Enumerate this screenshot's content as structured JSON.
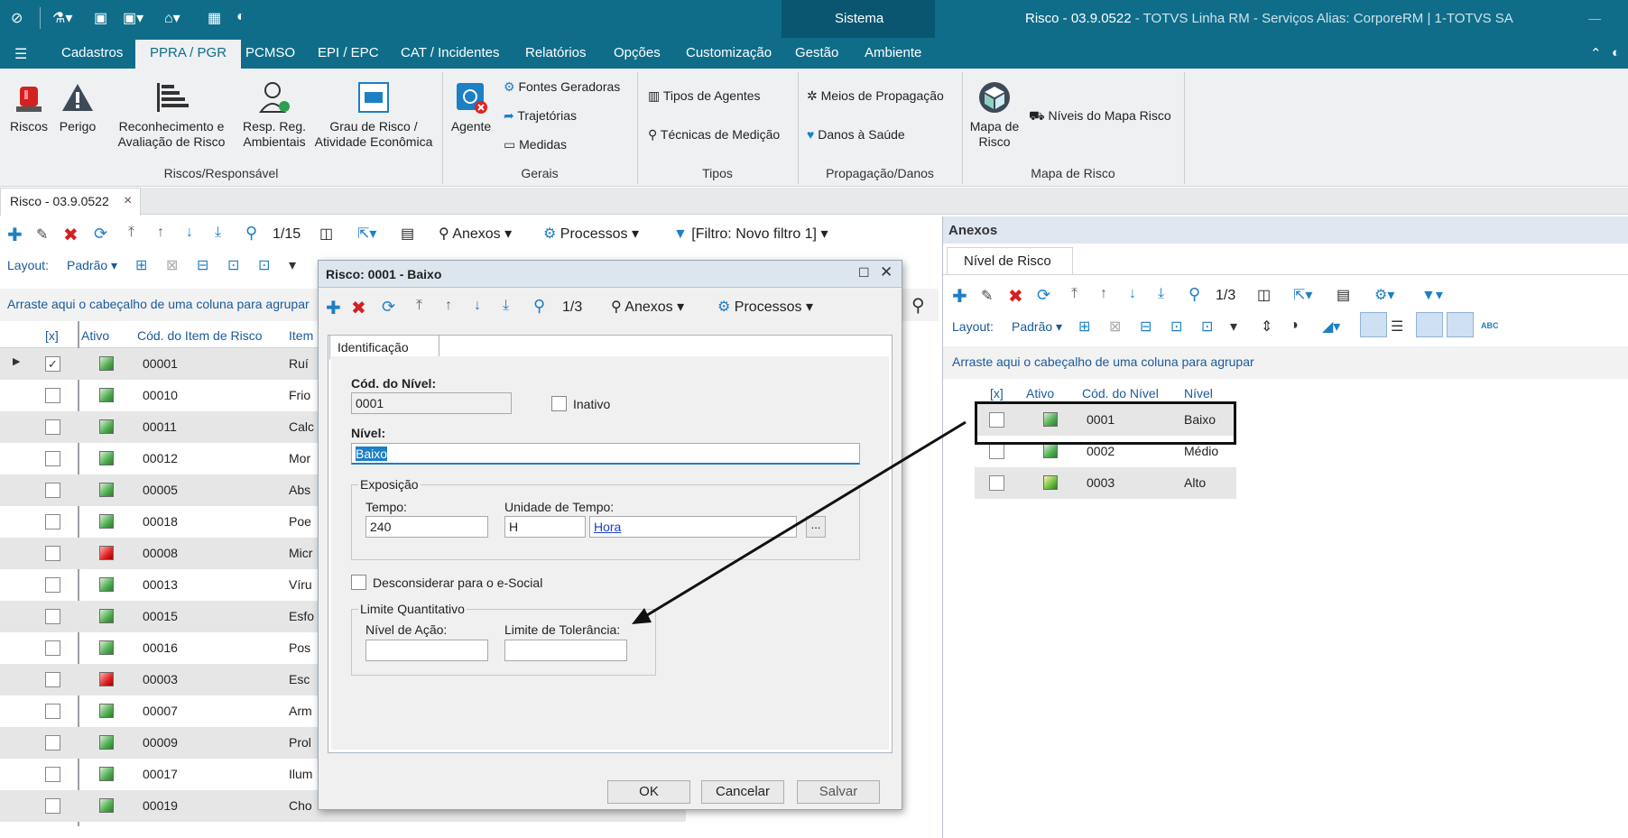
{
  "window": {
    "menu_section": "Sistema",
    "title": "Risco - 03.9.0522",
    "title_suffix": " - TOTVS Linha RM - Serviços  Alias: CorporeRM | 1-TOTVS SA",
    "minimize": "—"
  },
  "menu": {
    "tabs": [
      "Cadastros",
      "PPRA / PGR",
      "PCMSO",
      "EPI / EPC",
      "CAT / Incidentes",
      "Relatórios",
      "Opções",
      "Customização",
      "Gestão",
      "Ambiente"
    ]
  },
  "ribbon": {
    "riscos": "Riscos",
    "perigo": "Perigo",
    "reconhecimento_1": "Reconhecimento e",
    "reconhecimento_2": "Avaliação de Risco",
    "resp_1": "Resp. Reg.",
    "resp_2": "Ambientais",
    "grau_1": "Grau de Risco /",
    "grau_2": "Atividade Econômica",
    "agente": "Agente",
    "fontes": "Fontes Geradoras",
    "trajetorias": "Trajetórias",
    "medidas": "Medidas",
    "tipos_agentes": "Tipos de Agentes",
    "tecnicas": "Técnicas de Medição",
    "meios": "Meios de Propagação",
    "danos": "Danos à Saúde",
    "mapa_1": "Mapa de",
    "mapa_2": "Risco",
    "niveis": "Níveis do Mapa Risco",
    "groups": {
      "g1": "Riscos/Responsável",
      "g2": "Gerais",
      "g3": "Tipos",
      "g4": "Propagação/Danos",
      "g5": "Mapa de Risco"
    }
  },
  "doc_tab": {
    "label": "Risco - 03.9.0522",
    "close": "×"
  },
  "main_grid": {
    "counter": "1/15",
    "anexos": "Anexos",
    "processos": "Processos",
    "filtro": "[Filtro: Novo filtro 1]",
    "layout_label": "Layout:",
    "layout_value": "Padrão",
    "group_hint": "Arraste aqui o cabeçalho de uma coluna para agrupar",
    "headers": [
      "[x]",
      "Ativo",
      "Cód. do Item de Risco",
      "Item"
    ],
    "rows": [
      {
        "code": "00001",
        "item": "Ruí",
        "status": "green",
        "checked": true
      },
      {
        "code": "00010",
        "item": "Frio",
        "status": "green",
        "checked": false
      },
      {
        "code": "00011",
        "item": "Calc",
        "status": "green",
        "checked": false
      },
      {
        "code": "00012",
        "item": "Mor",
        "status": "green",
        "checked": false
      },
      {
        "code": "00005",
        "item": "Abs",
        "status": "green",
        "checked": false
      },
      {
        "code": "00018",
        "item": "Poe",
        "status": "green",
        "checked": false
      },
      {
        "code": "00008",
        "item": "Micr",
        "status": "red",
        "checked": false
      },
      {
        "code": "00013",
        "item": "Víru",
        "status": "green",
        "checked": false
      },
      {
        "code": "00015",
        "item": "Esfo",
        "status": "green",
        "checked": false
      },
      {
        "code": "00016",
        "item": "Pos",
        "status": "green",
        "checked": false
      },
      {
        "code": "00003",
        "item": "Esc",
        "status": "red",
        "checked": false
      },
      {
        "code": "00007",
        "item": "Arm",
        "status": "green",
        "checked": false
      },
      {
        "code": "00009",
        "item": "Prol",
        "status": "green",
        "checked": false
      },
      {
        "code": "00017",
        "item": "Ilum",
        "status": "green",
        "checked": false
      },
      {
        "code": "00019",
        "item": "Cho",
        "status": "green",
        "checked": false
      }
    ]
  },
  "dialog": {
    "title": "Risco: 0001 - Baixo",
    "counter": "1/3",
    "anexos": "Anexos",
    "processos": "Processos",
    "tab": "Identificação",
    "cod_label": "Cód. do Nível:",
    "cod_value": "0001",
    "inativo": "Inativo",
    "nivel_label": "Nível:",
    "nivel_value": "Baixo",
    "exposicao": "Exposição",
    "tempo_label": "Tempo:",
    "tempo_value": "240",
    "unidade_label": "Unidade de Tempo:",
    "unidade_code": "H",
    "unidade_link": "Hora",
    "lookup": "...",
    "desconsiderar": "Desconsiderar para o e-Social",
    "limite": "Limite Quantitativo",
    "nivel_acao": "Nível de Ação:",
    "limite_tol": "Limite de Tolerância:",
    "ok": "OK",
    "cancelar": "Cancelar",
    "salvar": "Salvar"
  },
  "anexos_panel": {
    "title": "Anexos",
    "tab": "Nível de Risco",
    "counter": "1/3",
    "layout_label": "Layout:",
    "layout_value": "Padrão",
    "abc": "ABC",
    "group_hint": "Arraste aqui o cabeçalho de uma coluna para agrupar",
    "headers": [
      "[x]",
      "Ativo",
      "Cód. do Nível",
      "Nível"
    ],
    "rows": [
      {
        "code": "0001",
        "nivel": "Baixo"
      },
      {
        "code": "0002",
        "nivel": "Médio"
      },
      {
        "code": "0003",
        "nivel": "Alto"
      }
    ]
  },
  "colors": {
    "header_blue": "#0f6d8a",
    "ribbon_bg": "#eef0f2",
    "link_blue": "#1a5a9b"
  }
}
